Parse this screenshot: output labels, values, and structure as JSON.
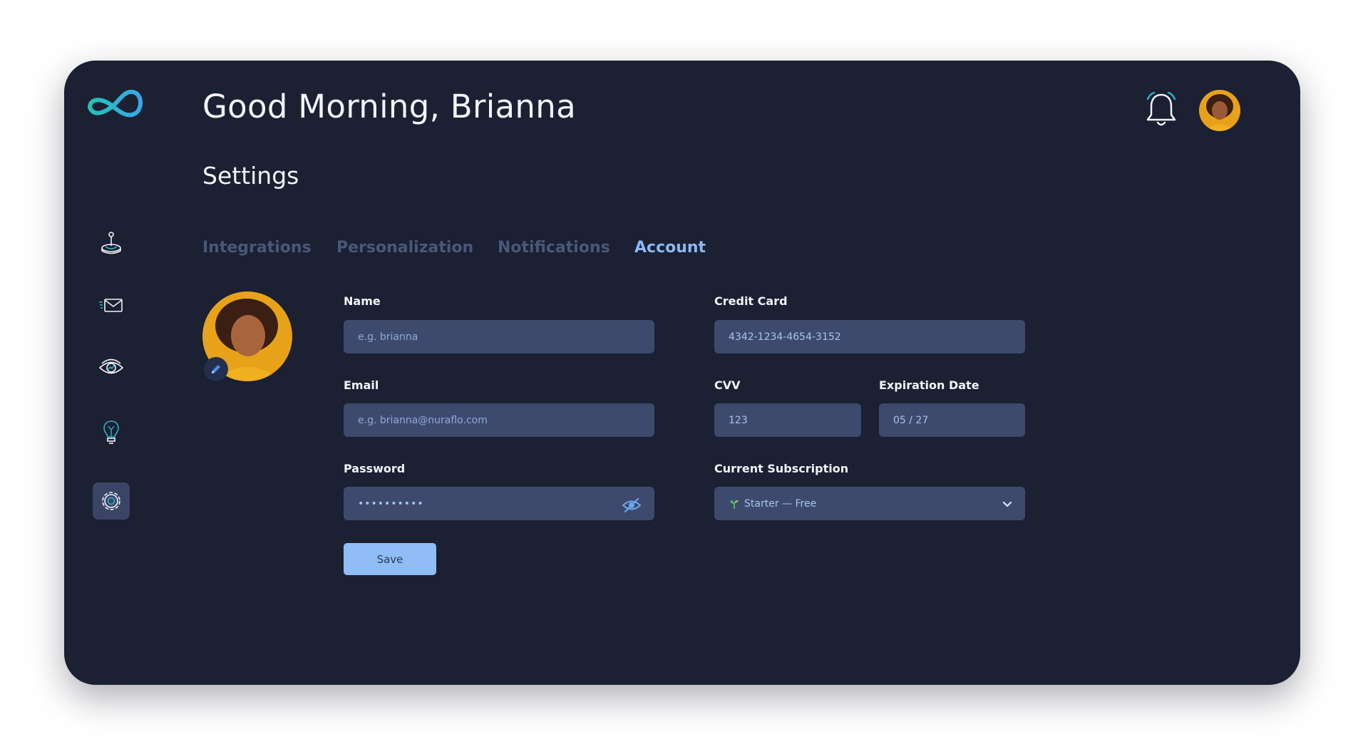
{
  "header": {
    "greeting": "Good Morning, Brianna",
    "section_title": "Settings"
  },
  "sidebar": {
    "items": [
      {
        "icon": "joystick-icon",
        "active": false
      },
      {
        "icon": "fast-mail-icon",
        "active": false
      },
      {
        "icon": "eye-chart-icon",
        "active": false
      },
      {
        "icon": "lightbulb-icon",
        "active": false
      },
      {
        "icon": "gear-icon",
        "active": true
      }
    ]
  },
  "tabs": [
    {
      "label": "Integrations",
      "active": false
    },
    {
      "label": "Personalization",
      "active": false
    },
    {
      "label": "Notifications",
      "active": false
    },
    {
      "label": "Account",
      "active": true
    }
  ],
  "form": {
    "name": {
      "label": "Name",
      "placeholder": "e.g. brianna"
    },
    "email": {
      "label": "Email",
      "placeholder": "e.g. brianna@nuraflo.com"
    },
    "password": {
      "label": "Password",
      "value": "••••••••••"
    },
    "credit_card": {
      "label": "Credit Card",
      "value": "4342-1234-4654-3152"
    },
    "cvv": {
      "label": "CVV",
      "value": "123"
    },
    "expiration": {
      "label": "Expiration Date",
      "value": "05 / 27"
    },
    "subscription": {
      "label": "Current Subscription",
      "value": "Starter — Free"
    },
    "save_label": "Save"
  },
  "colors": {
    "background": "#1b2032",
    "input": "#3d4a6e",
    "accent": "#8cb8f4",
    "teal": "#2ab3c6",
    "button": "#90bdf5"
  }
}
